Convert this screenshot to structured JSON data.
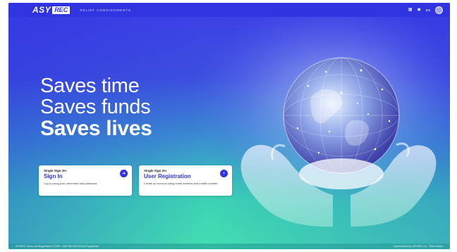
{
  "brand": {
    "logo_main": "ASY",
    "logo_box": "REC",
    "tagline": "RELIEF CONSIGNMENTS"
  },
  "topbar": {
    "icons": [
      "grid-icon",
      "help-icon"
    ],
    "language": "EN"
  },
  "hero": {
    "line1": "Saves time",
    "line2": "Saves funds",
    "line3": "Saves lives"
  },
  "cards": [
    {
      "kicker": "Single Sign On",
      "title": "Sign In",
      "description": "Log in using your username and password",
      "icon": "arrow-right-icon"
    },
    {
      "kicker": "Single Sign On",
      "title": "User Registration",
      "description": "Create an account using email address and mobile number",
      "icon": "add-user-icon"
    }
  ],
  "footer": {
    "left": "ASYREC Terms and Regulations © 2020 - UNCTAD ASYCUDA Programme",
    "right": "Implemented by: ASYREC 1.0 · Third Parties"
  },
  "colors": {
    "primary": "#3034e0",
    "gradient_top": "#3b3fe6",
    "gradient_bottom": "#43e0b0"
  }
}
